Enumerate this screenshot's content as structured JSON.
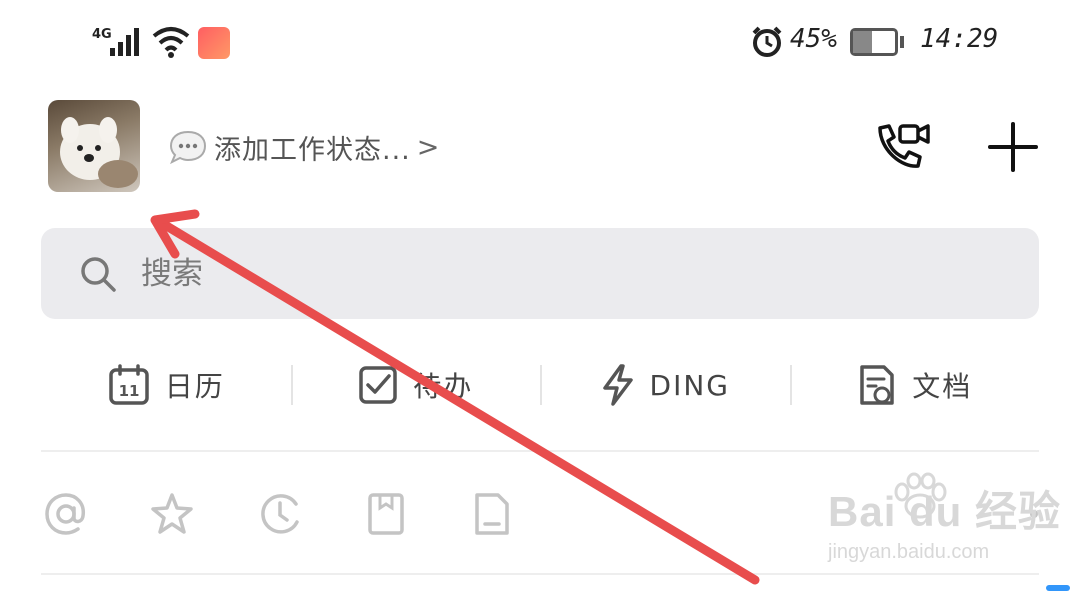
{
  "status_bar": {
    "network": "4G",
    "battery_percent": "45%",
    "time": "14:29",
    "battery_level": 0.45
  },
  "header": {
    "work_status_placeholder": "添加工作状态...",
    "work_status_chevron": ">"
  },
  "search": {
    "placeholder": "搜索"
  },
  "quick_actions": [
    {
      "label": "日历",
      "icon": "calendar-icon",
      "calendar_day": "11"
    },
    {
      "label": "待办",
      "icon": "checkbox-icon"
    },
    {
      "label": "DING",
      "icon": "lightning-icon"
    },
    {
      "label": "文档",
      "icon": "document-icon"
    }
  ],
  "filters": [
    {
      "icon": "at-icon"
    },
    {
      "icon": "star-icon"
    },
    {
      "icon": "clock-icon"
    },
    {
      "icon": "bookmark-icon"
    },
    {
      "icon": "file-icon"
    },
    {
      "icon": "more-icon"
    }
  ],
  "watermark": {
    "logo": "Bai du 经验",
    "site": "jingyan.baidu.com"
  },
  "colors": {
    "annotation_arrow": "#e84d4d",
    "search_bg": "#ebebee",
    "text_primary": "#222222",
    "text_secondary": "#555555"
  }
}
